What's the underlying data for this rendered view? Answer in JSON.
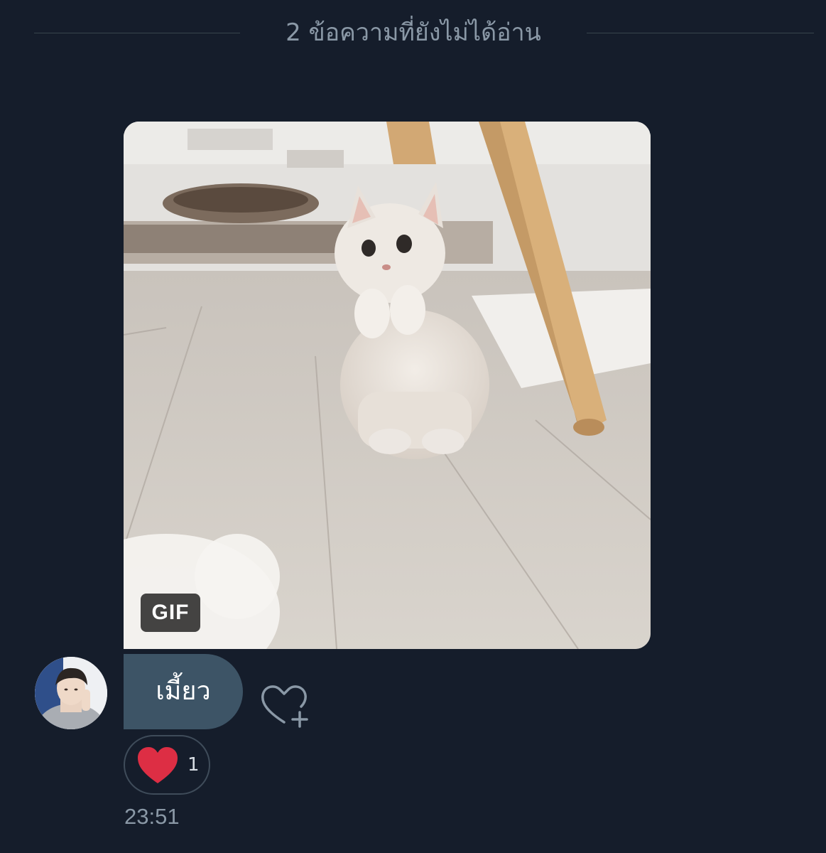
{
  "divider": {
    "unread_text": "2 ข้อความที่ยังไม่ได้อ่าน"
  },
  "message": {
    "media_badge": "GIF",
    "text": "เมี้ยว",
    "time": "23:51"
  },
  "reaction": {
    "emoji": "heart",
    "count": "1",
    "color": "#dd2e44"
  },
  "icons": {
    "add_reaction": "heart-plus-icon",
    "reaction": "heart-icon"
  },
  "colors": {
    "background": "#151d2b",
    "bubble": "#3d5466",
    "muted_text": "#8a98a6"
  }
}
